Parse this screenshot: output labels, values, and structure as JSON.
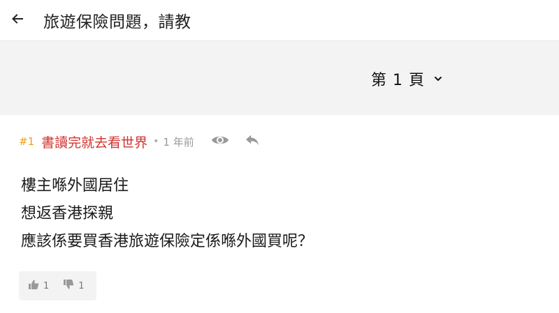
{
  "header": {
    "back_icon": "arrow-left-icon",
    "title": "旅遊保險問題，請教"
  },
  "pagination": {
    "label": "第 1 頁",
    "chevron_icon": "chevron-down-icon"
  },
  "post": {
    "floor": "#1",
    "author": "書讀完就去看世界",
    "separator": "•",
    "time": "1 年前",
    "view_icon": "eye-icon",
    "reply_icon": "reply-icon",
    "lines": [
      "樓主喺外國居住",
      "想返香港探親",
      "應該係要買香港旅遊保險定係喺外國買呢？"
    ],
    "votes": {
      "up_icon": "thumbs-up-icon",
      "up_count": "1",
      "down_icon": "thumbs-down-icon",
      "down_count": "1"
    }
  },
  "colors": {
    "floor": "#e6a21e",
    "author": "#d0322e",
    "page_bar_bg": "#f3f3f3"
  }
}
